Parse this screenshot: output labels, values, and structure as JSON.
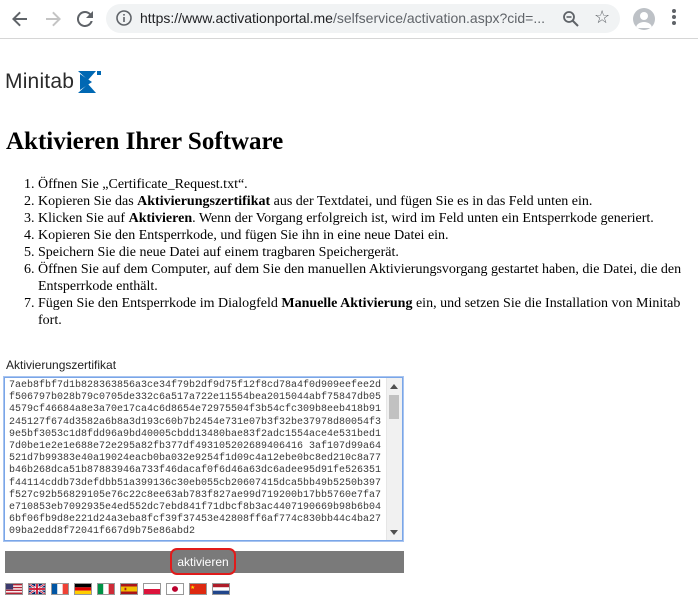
{
  "browser": {
    "url_main": "https://www.activationportal.me",
    "url_path": "/selfservice/activation.aspx?cid=..."
  },
  "brand": {
    "name": "Minitab",
    "accent_color": "#0068b3"
  },
  "page": {
    "title": "Aktivieren Ihrer Software",
    "steps": [
      [
        "Öffnen Sie „Certificate_Request.txt“."
      ],
      [
        "Kopieren Sie das ",
        {
          "b": "Aktivierungszertifikat"
        },
        " aus der Textdatei, und fügen Sie es in das Feld unten ein."
      ],
      [
        "Klicken Sie auf ",
        {
          "b": "Aktivieren"
        },
        ". Wenn der Vorgang erfolgreich ist, wird im Feld unten ein Entsperrkode generiert."
      ],
      [
        "Kopieren Sie den Entsperrkode, und fügen Sie ihn in eine neue Datei ein."
      ],
      [
        "Speichern Sie die neue Datei auf einem tragbaren Speichergerät."
      ],
      [
        "Öffnen Sie auf dem Computer, auf dem Sie den manuellen Aktivierungsvorgang gestartet haben, die Datei, die den Entsperrkode enthält."
      ],
      [
        "Fügen Sie den Entsperrkode im Dialogfeld ",
        {
          "b": "Manuelle Aktivierung"
        },
        " ein, und setzen Sie die Installation von Minitab fort."
      ]
    ],
    "cert_label": "Aktivierungszertifikat",
    "cert_value": "7aeb8fbf7d1b828363856a3ce34f79b2df9d75f12f8cd78a4f0d909eefee2df506797b028b79c0705de332c6a517a722e11554bea2015044abf75847db054579cf46684a8e3a70e17ca4c6d8654e72975504f3b54cfc309b8eeb418b91245127f674d3582a6b8a3d193c60b7b2454e731e07b3f32be37978d80054f39e5bf3053c1d8fdd96a9bd40005cbdd13480bae83f2adc1554ace4e531bed17d0be1e2e1e688e72e295a82fb377df493105202689406416 3af107d99a64521d7b99383e40a19024eacb0ba032e9254f1d09c4a12ebe0bc8ed210c8a77b46b268dca51b87883946a733f46dacaf0f6d46a63dc6adee95d91fe526351f44114cddb73defdbb51a399136c30eb055cb20607415dca5bb49b5250b397f527c92b56829105e76c22c8ee63ab783f827ae99d719200b17bb5760e7fa7e710853eb7092935e4ed552dc7ebd841f71dbcf8b3ac4407190669b98b6b046bf06fb9d8e221d24a3eba8fcf39f37453e42808ff6af774c830bb44c4ba2709ba2edd8f72041f667d9b75e86abd2",
    "activate_label": "aktivieren"
  },
  "flags": [
    {
      "name": "flag-us-icon"
    },
    {
      "name": "flag-uk-icon"
    },
    {
      "name": "flag-fr-icon"
    },
    {
      "name": "flag-de-icon"
    },
    {
      "name": "flag-it-icon"
    },
    {
      "name": "flag-es-icon"
    },
    {
      "name": "flag-pl-icon"
    },
    {
      "name": "flag-jp-icon"
    },
    {
      "name": "flag-cn-icon"
    },
    {
      "name": "flag-nl-icon"
    }
  ]
}
